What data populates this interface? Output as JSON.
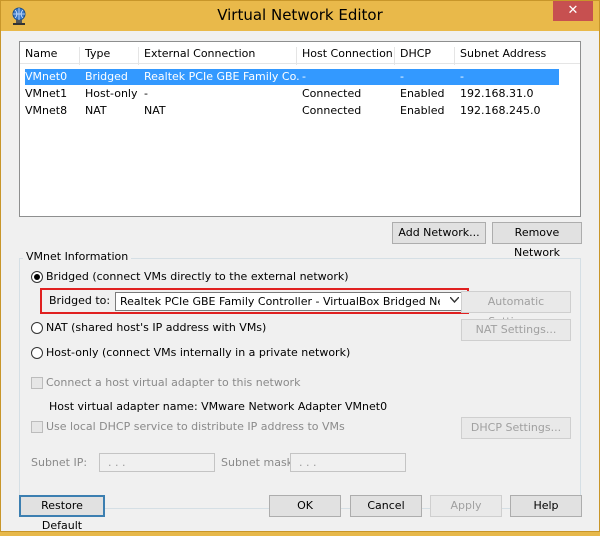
{
  "window": {
    "title": "Virtual Network Editor",
    "close_glyph": "✕"
  },
  "list": {
    "columns": [
      "Name",
      "Type",
      "External Connection",
      "Host Connection",
      "DHCP",
      "Subnet Address"
    ],
    "rows": [
      {
        "name": "VMnet0",
        "type": "Bridged",
        "external": "Realtek PCIe GBE Family Co...",
        "host": "-",
        "dhcp": "-",
        "subnet": "-"
      },
      {
        "name": "VMnet1",
        "type": "Host-only",
        "external": "-",
        "host": "Connected",
        "dhcp": "Enabled",
        "subnet": "192.168.31.0"
      },
      {
        "name": "VMnet8",
        "type": "NAT",
        "external": "NAT",
        "host": "Connected",
        "dhcp": "Enabled",
        "subnet": "192.168.245.0"
      }
    ],
    "selected_row": 0
  },
  "buttons": {
    "add_network": "Add Network...",
    "remove_network": "Remove Network",
    "automatic_settings": "Automatic Settings...",
    "nat_settings": "NAT Settings...",
    "dhcp_settings": "DHCP Settings...",
    "restore_default": "Restore Default",
    "ok": "OK",
    "cancel": "Cancel",
    "apply": "Apply",
    "help": "Help"
  },
  "vmnet_info": {
    "group_label": "VMnet Information",
    "bridged_label": "Bridged (connect VMs directly to the external network)",
    "bridged_to_label": "Bridged to:",
    "bridged_to_value": "Realtek PCIe GBE Family Controller - VirtualBox Bridged Networking",
    "nat_label": "NAT (shared host's IP address with VMs)",
    "host_only_label": "Host-only (connect VMs internally in a private network)",
    "selected_mode": "bridged",
    "connect_adapter_label": "Connect a host virtual adapter to this network",
    "adapter_name_label": "Host virtual adapter name: VMware Network Adapter VMnet0",
    "dhcp_label": "Use local DHCP service to distribute IP address to VMs",
    "subnet_ip_label": "Subnet IP:",
    "subnet_mask_label": "Subnet mask:",
    "subnet_ip_value": " .  .  . ",
    "subnet_mask_value": " .  .  . "
  },
  "colors": {
    "titlebar": "#e9b94a",
    "selection": "#3399ff",
    "highlight_box": "#e02020",
    "close_button": "#c75050"
  },
  "icons": {
    "app": "network-globe-icon",
    "close": "close-icon",
    "dropdown": "chevron-down-icon"
  }
}
